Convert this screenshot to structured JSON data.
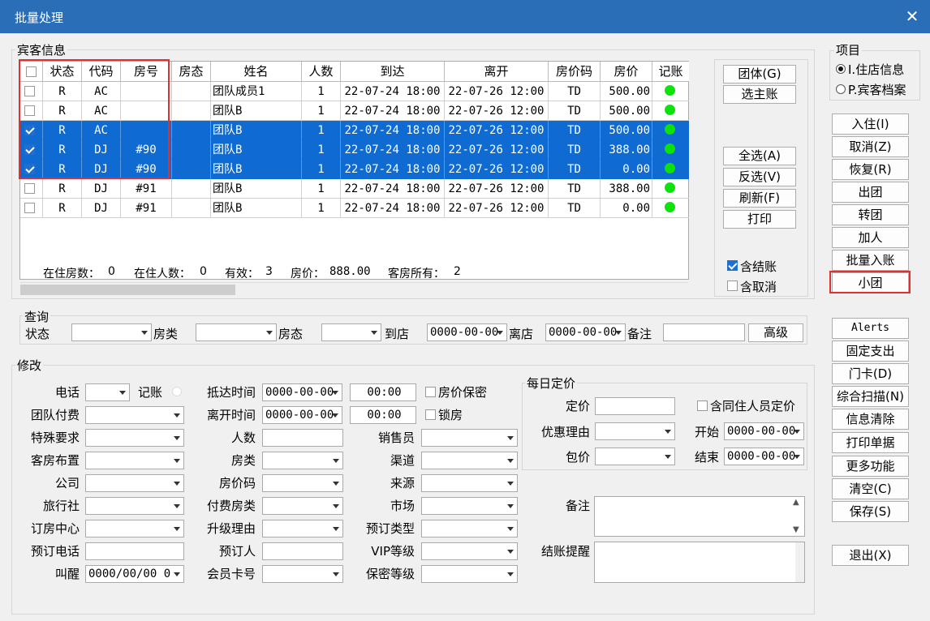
{
  "window": {
    "title": "批量处理",
    "close": "✕"
  },
  "guest_group": {
    "label": "宾客信息"
  },
  "grid": {
    "headers": [
      "状态",
      "代码",
      "房号",
      "房态",
      "姓名",
      "人数",
      "到达",
      "离开",
      "房价码",
      "房价",
      "记账"
    ],
    "rows": [
      {
        "checked": false,
        "selected": false,
        "status": "R",
        "code": "AC",
        "room": "",
        "room_state": "",
        "name": "团队成员1",
        "people": "1",
        "arrive": "22-07-24 18:00",
        "leave": "22-07-26 12:00",
        "rate_code": "TD",
        "rate": "500.00"
      },
      {
        "checked": false,
        "selected": false,
        "status": "R",
        "code": "AC",
        "room": "",
        "room_state": "",
        "name": "团队B",
        "people": "1",
        "arrive": "22-07-24 18:00",
        "leave": "22-07-26 12:00",
        "rate_code": "TD",
        "rate": "500.00"
      },
      {
        "checked": true,
        "selected": true,
        "status": "R",
        "code": "AC",
        "room": "",
        "room_state": "",
        "name": "团队B",
        "people": "1",
        "arrive": "22-07-24 18:00",
        "leave": "22-07-26 12:00",
        "rate_code": "TD",
        "rate": "500.00"
      },
      {
        "checked": true,
        "selected": true,
        "status": "R",
        "code": "DJ",
        "room": "#90",
        "room_state": "",
        "name": "团队B",
        "people": "1",
        "arrive": "22-07-24 18:00",
        "leave": "22-07-26 12:00",
        "rate_code": "TD",
        "rate": "388.00"
      },
      {
        "checked": true,
        "selected": true,
        "status": "R",
        "code": "DJ",
        "room": "#90",
        "room_state": "",
        "name": "团队B",
        "people": "1",
        "arrive": "22-07-24 18:00",
        "leave": "22-07-26 12:00",
        "rate_code": "TD",
        "rate": "0.00"
      },
      {
        "checked": false,
        "selected": false,
        "status": "R",
        "code": "DJ",
        "room": "#91",
        "room_state": "",
        "name": "团队B",
        "people": "1",
        "arrive": "22-07-24 18:00",
        "leave": "22-07-26 12:00",
        "rate_code": "TD",
        "rate": "388.00"
      },
      {
        "checked": false,
        "selected": false,
        "status": "R",
        "code": "DJ",
        "room": "#91",
        "room_state": "",
        "name": "团队B",
        "people": "1",
        "arrive": "22-07-24 18:00",
        "leave": "22-07-26 12:00",
        "rate_code": "TD",
        "rate": "0.00"
      }
    ],
    "footer": {
      "in_rooms_label": "在住房数：",
      "in_rooms": "0",
      "in_people_label": "在住人数：",
      "in_people": "0",
      "valid_label": "有效：",
      "valid": "3",
      "price_label": "房价：",
      "price": "888.00",
      "owned_label": "客房所有：",
      "owned": "2"
    }
  },
  "grid_buttons": {
    "group": "团体(G)",
    "main_acct": "选主账",
    "select_all": "全选(A)",
    "invert": "反选(V)",
    "refresh": "刷新(F)",
    "print": "打印"
  },
  "grid_options": {
    "include_settled": "含结账",
    "include_cancel": "含取消",
    "include_settled_checked": true,
    "include_cancel_checked": false
  },
  "items": {
    "label": "项目",
    "opt1": "I.住店信息",
    "opt2": "P.宾客档案"
  },
  "right_buttons": [
    "入住(I)",
    "取消(Z)",
    "恢复(R)",
    "出团",
    "转团",
    "加人",
    "批量入账",
    "小团"
  ],
  "right_buttons2": [
    "Alerts",
    "固定支出",
    "门卡(D)",
    "综合扫描(N)",
    "信息清除",
    "打印单据",
    "更多功能",
    "清空(C)",
    "保存(S)"
  ],
  "exit": "退出(X)",
  "query": {
    "label": "查询",
    "status": "状态",
    "room_type": "房类",
    "room_state": "房态",
    "arrive": "到店",
    "arrive_val": "0000-00-00",
    "leave": "离店",
    "leave_val": "0000-00-00",
    "note": "备注",
    "advanced": "高级"
  },
  "modify": {
    "label": "修改",
    "phone": "电话",
    "bookkeep": "记账",
    "team_pay": "团队付费",
    "special": "特殊要求",
    "room_layout": "客房布置",
    "company": "公司",
    "agency": "旅行社",
    "booking_center": "订房中心",
    "booking_phone": "预订电话",
    "wake": "叫醒",
    "wake_val": "0000/00/00 0",
    "arrive_time": "抵达时间",
    "leave_time": "离开时间",
    "date_val": "0000-00-00",
    "time_val": "00:00",
    "people": "人数",
    "room_type": "房类",
    "rate_code": "房价码",
    "pay_room_type": "付费房类",
    "upgrade_reason": "升级理由",
    "booker": "预订人",
    "member_card": "会员卡号",
    "price_secret": "房价保密",
    "lock_room": "锁房",
    "salesman": "销售员",
    "channel": "渠道",
    "source": "来源",
    "market": "市场",
    "booking_type": "预订类型",
    "vip": "VIP等级",
    "secret_level": "保密等级",
    "daily_rate": "每日定价",
    "rate": "定价",
    "include_cohabit": "含同住人员定价",
    "discount_reason": "优惠理由",
    "start": "开始",
    "package": "包价",
    "end": "结束",
    "remark": "备注",
    "checkout_remind": "结账提醒"
  }
}
